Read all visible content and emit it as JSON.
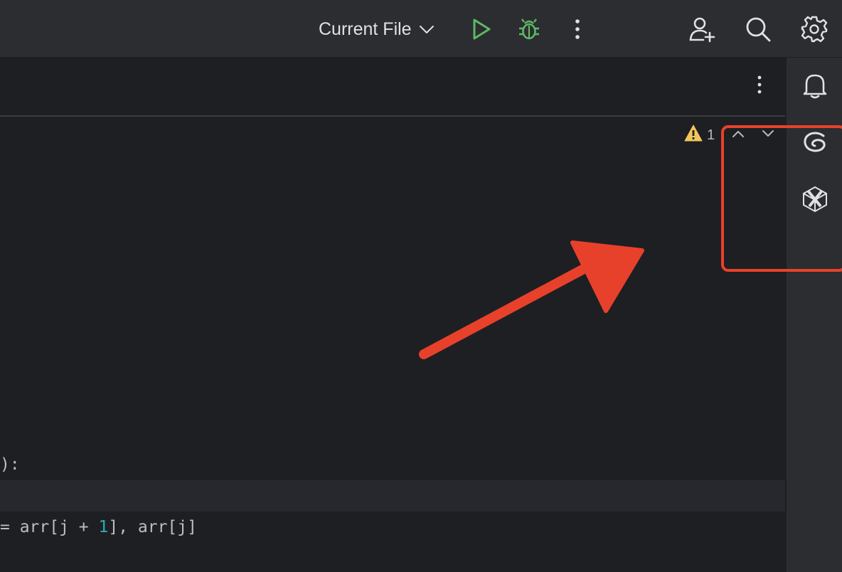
{
  "toolbar": {
    "run_config_label": "Current File",
    "icons": {
      "run": "run-icon",
      "debug": "debug-icon",
      "more": "more-vertical-icon",
      "add_user": "add-user-icon",
      "search": "search-icon",
      "settings": "gear-icon"
    }
  },
  "editor": {
    "inspection_count": "1",
    "code_lines": [
      {
        "text": "):"
      },
      {
        "text": ""
      },
      {
        "before": "= arr[j + ",
        "number": "1",
        "after": "], arr[j]"
      }
    ]
  },
  "right_strip": {
    "icons": [
      "bell-icon",
      "swirl-ai-icon",
      "hexagon-ai-icon"
    ]
  },
  "annotation": {
    "box_color": "#e8412b",
    "arrow_color": "#e8412b"
  },
  "colors": {
    "run_green": "#5fb865",
    "debug_green": "#5fb865",
    "warning_amber": "#f2c55c",
    "number_teal": "#2aacb8"
  }
}
